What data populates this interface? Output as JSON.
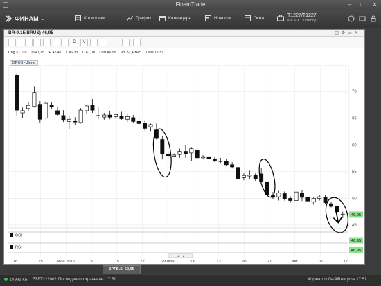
{
  "window": {
    "title": "FinamTrade"
  },
  "toolbar": {
    "logo": "ФИНАМ",
    "quotes": "Котировки",
    "chart": "График",
    "calendar": "Календарь",
    "news": "Новости",
    "windows": "Окна",
    "account_line1": "T1227/T1227",
    "account_line2": "MICEX Currency"
  },
  "chart_window": {
    "title": "BR-9.15(BRUS) 46,95",
    "ohlc": {
      "chg_label": "Chg",
      "chg": "-0,11%",
      "open_label": "O",
      "open": "47,15",
      "high_label": "H",
      "high": "47,47",
      "low_label": "L",
      "low": "46,33",
      "close_label": "C",
      "close": "47,00",
      "last_label": "Last",
      "last": "46,95",
      "vol_label": "Vol",
      "vol": "32,4 тыс.",
      "date_label": "Date",
      "date": "17:51"
    },
    "instrument_tag": "BRUS - День",
    "tools": [
      "",
      "",
      "",
      "",
      "",
      "",
      "",
      "D",
      "V",
      "",
      "",
      "",
      ""
    ],
    "panel_labels": {
      "cci": "CCI",
      "rsi": "RSI"
    },
    "last_price_badge": "46,95",
    "cci_badge": "46,95",
    "rsi_badge": "46,95"
  },
  "window_tabs": [
    {
      "label": "SPFB.Si 62,95"
    }
  ],
  "status": {
    "left1": "14991 КБ",
    "left2": "FZFT222062",
    "saved": "Последнее сохранение: 17:51",
    "journal": "Журнал событий",
    "date": "20 Августа 17:51"
  },
  "chart_data": {
    "type": "candlestick",
    "title": "",
    "ylim": [
      45,
      73
    ],
    "y_ticks": [
      45,
      50,
      55,
      60,
      65,
      70
    ],
    "x_tick_labels": [
      "18",
      "25",
      "июн 2015",
      "8",
      "15",
      "22",
      "29 июн",
      "06",
      "13",
      "20",
      "27",
      "авг",
      "10",
      "17"
    ],
    "candles": [
      {
        "o": 73.0,
        "h": 73.5,
        "l": 65.5,
        "c": 66.5
      },
      {
        "o": 66.0,
        "h": 67.0,
        "l": 65.0,
        "c": 66.4
      },
      {
        "o": 66.8,
        "h": 68.0,
        "l": 66.3,
        "c": 67.4
      },
      {
        "o": 67.2,
        "h": 71.0,
        "l": 67.0,
        "c": 69.8
      },
      {
        "o": 67.6,
        "h": 68.2,
        "l": 64.2,
        "c": 64.8
      },
      {
        "o": 65.0,
        "h": 68.2,
        "l": 64.8,
        "c": 67.8
      },
      {
        "o": 67.4,
        "h": 68.0,
        "l": 66.8,
        "c": 67.2
      },
      {
        "o": 66.4,
        "h": 67.2,
        "l": 65.4,
        "c": 65.7
      },
      {
        "o": 65.5,
        "h": 66.5,
        "l": 64.3,
        "c": 64.6
      },
      {
        "o": 64.4,
        "h": 65.4,
        "l": 63.0,
        "c": 64.8
      },
      {
        "o": 64.4,
        "h": 65.2,
        "l": 63.8,
        "c": 64.3
      },
      {
        "o": 64.2,
        "h": 66.9,
        "l": 64.0,
        "c": 66.5
      },
      {
        "o": 66.4,
        "h": 67.5,
        "l": 65.8,
        "c": 67.3
      },
      {
        "o": 67.4,
        "h": 68.6,
        "l": 66.0,
        "c": 66.5
      },
      {
        "o": 65.5,
        "h": 67.0,
        "l": 64.8,
        "c": 65.4
      },
      {
        "o": 65.2,
        "h": 66.0,
        "l": 64.6,
        "c": 65.6
      },
      {
        "o": 65.6,
        "h": 66.4,
        "l": 64.8,
        "c": 65.2
      },
      {
        "o": 65.3,
        "h": 65.9,
        "l": 64.9,
        "c": 65.7
      },
      {
        "o": 65.4,
        "h": 66.2,
        "l": 64.6,
        "c": 64.9
      },
      {
        "o": 64.8,
        "h": 65.7,
        "l": 64.3,
        "c": 65.3
      },
      {
        "o": 65.1,
        "h": 65.6,
        "l": 64.1,
        "c": 64.4
      },
      {
        "o": 64.4,
        "h": 65.0,
        "l": 63.7,
        "c": 64.0
      },
      {
        "o": 64.0,
        "h": 64.5,
        "l": 62.7,
        "c": 63.1
      },
      {
        "o": 63.4,
        "h": 64.0,
        "l": 62.6,
        "c": 63.8
      },
      {
        "o": 62.8,
        "h": 64.0,
        "l": 61.0,
        "c": 61.2
      },
      {
        "o": 61.0,
        "h": 61.6,
        "l": 57.3,
        "c": 58.4
      },
      {
        "o": 58.2,
        "h": 58.8,
        "l": 57.6,
        "c": 58.0
      },
      {
        "o": 57.9,
        "h": 58.4,
        "l": 57.7,
        "c": 58.1
      },
      {
        "o": 58.2,
        "h": 59.3,
        "l": 57.6,
        "c": 58.8
      },
      {
        "o": 58.8,
        "h": 59.9,
        "l": 57.6,
        "c": 58.3
      },
      {
        "o": 58.5,
        "h": 59.6,
        "l": 57.0,
        "c": 59.3
      },
      {
        "o": 59.0,
        "h": 59.5,
        "l": 57.3,
        "c": 57.6
      },
      {
        "o": 57.6,
        "h": 58.1,
        "l": 57.3,
        "c": 57.8
      },
      {
        "o": 57.8,
        "h": 58.3,
        "l": 57.0,
        "c": 57.4
      },
      {
        "o": 57.4,
        "h": 57.8,
        "l": 56.8,
        "c": 57.0
      },
      {
        "o": 57.0,
        "h": 57.6,
        "l": 56.5,
        "c": 56.9
      },
      {
        "o": 56.9,
        "h": 57.4,
        "l": 56.0,
        "c": 56.3
      },
      {
        "o": 56.3,
        "h": 56.8,
        "l": 55.6,
        "c": 55.9
      },
      {
        "o": 55.8,
        "h": 56.3,
        "l": 53.2,
        "c": 53.6
      },
      {
        "o": 53.9,
        "h": 54.7,
        "l": 53.4,
        "c": 54.3
      },
      {
        "o": 54.2,
        "h": 55.2,
        "l": 53.6,
        "c": 54.4
      },
      {
        "o": 54.3,
        "h": 54.7,
        "l": 53.2,
        "c": 53.7
      },
      {
        "o": 54.6,
        "h": 55.7,
        "l": 52.8,
        "c": 53.1
      },
      {
        "o": 53.0,
        "h": 53.2,
        "l": 50.4,
        "c": 50.7
      },
      {
        "o": 50.5,
        "h": 51.2,
        "l": 49.8,
        "c": 50.2
      },
      {
        "o": 50.3,
        "h": 51.4,
        "l": 49.6,
        "c": 51.0
      },
      {
        "o": 50.9,
        "h": 51.3,
        "l": 49.6,
        "c": 49.9
      },
      {
        "o": 50.0,
        "h": 50.4,
        "l": 49.2,
        "c": 49.6
      },
      {
        "o": 49.6,
        "h": 51.6,
        "l": 49.2,
        "c": 51.2
      },
      {
        "o": 51.0,
        "h": 51.5,
        "l": 49.5,
        "c": 50.2
      },
      {
        "o": 50.2,
        "h": 50.6,
        "l": 49.3,
        "c": 49.5
      },
      {
        "o": 49.3,
        "h": 50.3,
        "l": 48.8,
        "c": 50.0
      },
      {
        "o": 50.0,
        "h": 50.7,
        "l": 49.6,
        "c": 50.3
      },
      {
        "o": 50.2,
        "h": 50.6,
        "l": 48.9,
        "c": 49.2
      },
      {
        "o": 49.0,
        "h": 49.3,
        "l": 48.3,
        "c": 48.5
      },
      {
        "o": 48.5,
        "h": 49.0,
        "l": 46.5,
        "c": 47.5
      },
      {
        "o": 47.0,
        "h": 47.5,
        "l": 46.3,
        "c": 47.0
      }
    ],
    "grid": true,
    "annotations": [
      "circle",
      "circle",
      "circle",
      "arrow-down"
    ]
  }
}
